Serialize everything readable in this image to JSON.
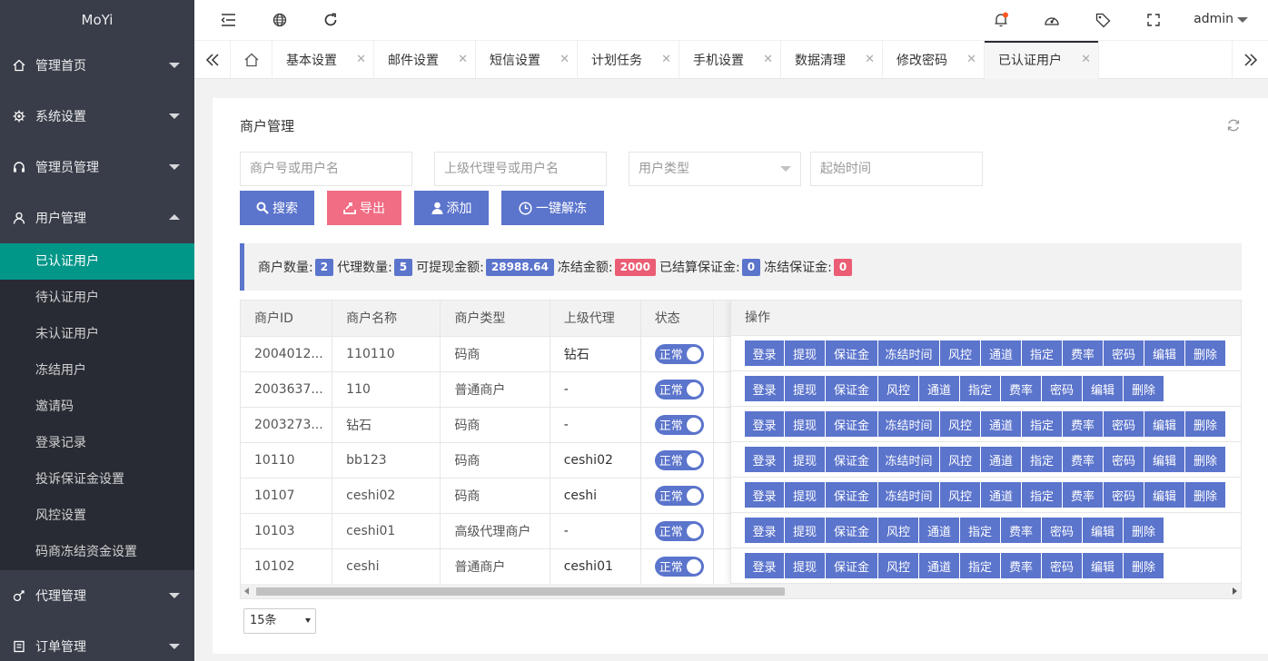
{
  "app": {
    "logo": "MoYi",
    "user": "admin"
  },
  "sidebar": {
    "groups": [
      {
        "label": "管理首页",
        "icon": "home-icon"
      },
      {
        "label": "系统设置",
        "icon": "gear-icon"
      },
      {
        "label": "管理员管理",
        "icon": "headset-icon"
      },
      {
        "label": "用户管理",
        "icon": "user-icon"
      },
      {
        "label": "代理管理",
        "icon": "agent-icon"
      },
      {
        "label": "订单管理",
        "icon": "order-icon"
      }
    ],
    "user_items": [
      "已认证用户",
      "待认证用户",
      "未认证用户",
      "冻结用户",
      "邀请码",
      "登录记录",
      "投诉保证金设置",
      "风控设置",
      "码商冻结资金设置"
    ],
    "active_item": "已认证用户"
  },
  "tabs": [
    "基本设置",
    "邮件设置",
    "短信设置",
    "计划任务",
    "手机设置",
    "数据清理",
    "修改密码",
    "已认证用户"
  ],
  "panel": {
    "title": "商户管理"
  },
  "filters": {
    "merchant_placeholder": "商户号或用户名",
    "parent_placeholder": "上级代理号或用户名",
    "type_placeholder": "用户类型",
    "start_placeholder": "起始时间"
  },
  "buttons": {
    "search": "搜索",
    "export": "导出",
    "add": "添加",
    "unfreeze": "一键解冻"
  },
  "stats": {
    "merchant_count_label": "商户数量:",
    "merchant_count": "2",
    "agent_count_label": "代理数量:",
    "agent_count": "5",
    "withdrawable_label": "可提现金额:",
    "withdrawable": "28988.64",
    "frozen_label": "冻结金额:",
    "frozen": "2000",
    "settled_deposit_label": "已结算保证金:",
    "settled_deposit": "0",
    "frozen_deposit_label": "冻结保证金:",
    "frozen_deposit": "0",
    "colors": {
      "blue": "#5b74cc",
      "red": "#ea5d74"
    }
  },
  "table": {
    "columns": [
      "商户ID",
      "商户名称",
      "商户类型",
      "上级代理",
      "状态",
      "操作"
    ],
    "rows": [
      {
        "id": "2004012...",
        "name": "110110",
        "type": "码商",
        "parent": "钻石",
        "status": "正常"
      },
      {
        "id": "2003637...",
        "name": "110",
        "type": "普通商户",
        "parent": "-",
        "status": "正常"
      },
      {
        "id": "2003273...",
        "name": "钻石",
        "type": "码商",
        "parent": "-",
        "status": "正常"
      },
      {
        "id": "10110",
        "name": "bb123",
        "type": "码商",
        "parent": "ceshi02",
        "status": "正常"
      },
      {
        "id": "10107",
        "name": "ceshi02",
        "type": "码商",
        "parent": "ceshi",
        "status": "正常"
      },
      {
        "id": "10103",
        "name": "ceshi01",
        "type": "高级代理商户",
        "parent": "-",
        "status": "正常"
      },
      {
        "id": "10102",
        "name": "ceshi",
        "type": "普通商户",
        "parent": "ceshi01",
        "status": "正常"
      }
    ],
    "actions_full": [
      "登录",
      "提现",
      "保证金",
      "冻结时间",
      "风控",
      "通道",
      "指定",
      "费率",
      "密码",
      "编辑",
      "删除"
    ],
    "actions_short": [
      "登录",
      "提现",
      "保证金",
      "风控",
      "通道",
      "指定",
      "费率",
      "密码",
      "编辑",
      "删除"
    ],
    "row_action_sets": [
      "full",
      "short",
      "full",
      "full",
      "full",
      "short",
      "short"
    ]
  },
  "pagination": {
    "page_size": "15条"
  },
  "colors": {
    "sidebar_bg": "#393d49",
    "active_green": "#009688",
    "accent_blue": "#5b74cc",
    "export_pink": "#f06d84"
  }
}
